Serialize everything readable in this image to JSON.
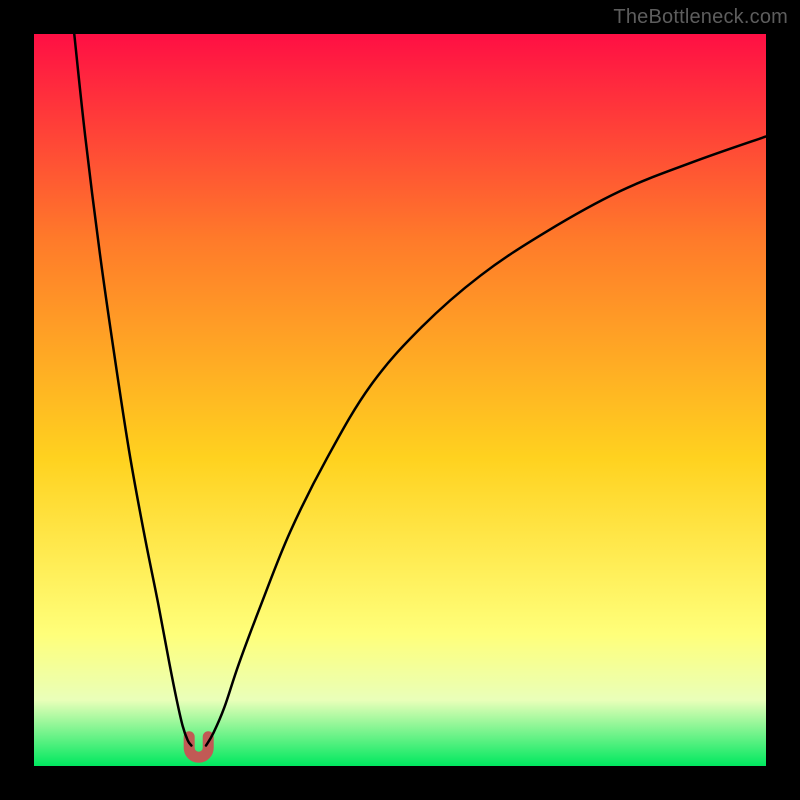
{
  "watermark": {
    "text": "TheBottleneck.com"
  },
  "colors": {
    "gradient_top": "#ff0f44",
    "gradient_mid_upper": "#ff7a2a",
    "gradient_mid": "#ffd21f",
    "gradient_lower": "#ffff7a",
    "gradient_pale": "#e9ffb9",
    "gradient_bottom": "#00e85f",
    "curve": "#000000",
    "marker": "#c15a55",
    "frame": "#000000"
  },
  "chart_data": {
    "type": "line",
    "title": "",
    "xlabel": "",
    "ylabel": "",
    "xlim": [
      0,
      100
    ],
    "ylim": [
      0,
      100
    ],
    "grid": false,
    "legend": false,
    "series": [
      {
        "name": "left_branch",
        "x": [
          5.5,
          7,
          9,
          11,
          13,
          15,
          17,
          18.5,
          19.5,
          20.3,
          21,
          21.5
        ],
        "y": [
          100,
          86,
          70,
          56,
          43,
          32,
          22,
          14,
          9,
          5.5,
          3.5,
          2.8
        ]
      },
      {
        "name": "right_branch",
        "x": [
          23.5,
          24.5,
          26,
          28,
          31,
          35,
          40,
          46,
          53,
          61,
          70,
          80,
          90,
          100
        ],
        "y": [
          2.8,
          4.5,
          8,
          14,
          22,
          32,
          42,
          52,
          60,
          67,
          73,
          78.5,
          82.5,
          86
        ]
      }
    ],
    "marker": {
      "note": "U-shaped highlight at curve minimum",
      "x_center": 22.5,
      "x_half_width": 1.3,
      "y_bottom": 1.2,
      "y_top": 4.0
    },
    "gradient_stops_pct": [
      {
        "offset": 0,
        "color": "#ff0f44"
      },
      {
        "offset": 28,
        "color": "#ff7a2a"
      },
      {
        "offset": 58,
        "color": "#ffd21f"
      },
      {
        "offset": 82,
        "color": "#ffff7a"
      },
      {
        "offset": 91,
        "color": "#e9ffb9"
      },
      {
        "offset": 100,
        "color": "#00e85f"
      }
    ]
  }
}
